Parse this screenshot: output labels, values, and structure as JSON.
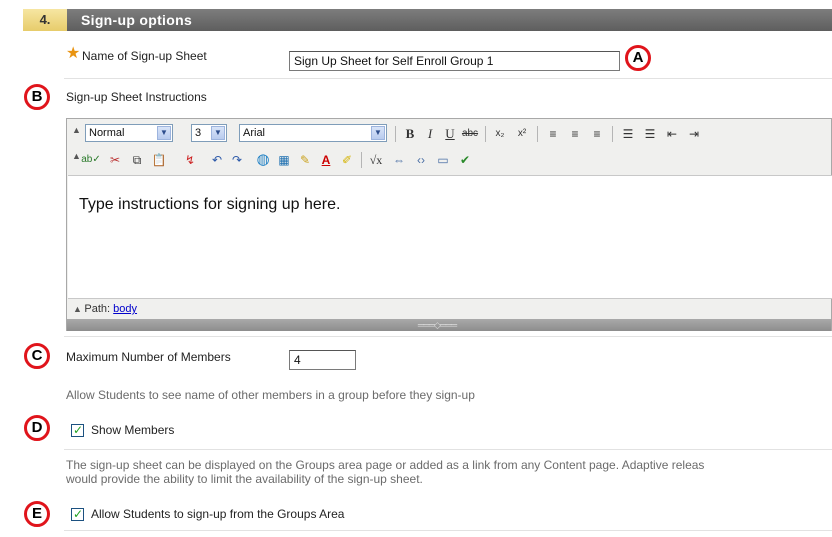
{
  "section": {
    "number": "4.",
    "title": "Sign-up options"
  },
  "name_field": {
    "label": "Name of Sign-up Sheet",
    "value": "Sign Up Sheet for Self Enroll Group 1"
  },
  "instructions": {
    "label": "Sign-up Sheet Instructions",
    "editor_text": "Type instructions for signing up here.",
    "path_label": "Path:",
    "path_value": "body"
  },
  "toolbar": {
    "format_value": "Normal",
    "size_value": "3",
    "font_value": "Arial",
    "bold": "B",
    "italic": "I",
    "underline": "U",
    "strikethrough": "abc"
  },
  "max_members": {
    "label": "Maximum Number of Members",
    "value": "4"
  },
  "show_members": {
    "help": "Allow Students to see name of other members in a group before they sign-up",
    "label": "Show Members",
    "checked": true
  },
  "allow_signup": {
    "help_line1": "The sign-up sheet can be displayed on the Groups area page or added as a link from any Content page. Adaptive releas",
    "help_line2": "would provide the ability to limit the availability of the sign-up sheet.",
    "label": "Allow Students to sign-up from the Groups Area",
    "checked": true
  },
  "callouts": {
    "a": "A",
    "b": "B",
    "c": "C",
    "d": "D",
    "e": "E"
  },
  "colors": {
    "callout_ring": "#e0141b",
    "required_star": "#e99412",
    "header_bg": "#6e6e6e",
    "number_bg": "#eed684"
  }
}
